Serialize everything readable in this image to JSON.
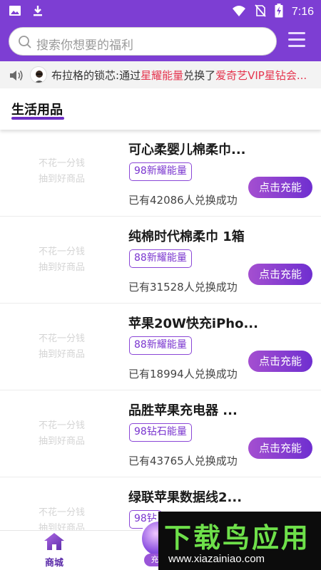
{
  "status_bar": {
    "time": "7:16",
    "left_icons": [
      "image-icon",
      "download-icon"
    ],
    "right_icons": [
      "wifi-icon",
      "no-sim-icon",
      "battery-charging-icon"
    ]
  },
  "search": {
    "placeholder": "搜索你想要的福利",
    "icon": "search-icon",
    "menu_icon": "menu-icon"
  },
  "notice": {
    "user": "布拉格的锁芯",
    "text_prefix": ":通过",
    "highlight_1": "星耀能量",
    "text_middle": "兑换了",
    "highlight_2": "爱奇艺VIP星钻会..."
  },
  "category": {
    "title": "生活用品"
  },
  "thumb_placeholder": {
    "line1": "不花一分钱",
    "line2": "抽到好商品"
  },
  "products": [
    {
      "name": "可心柔婴儿棉柔巾...",
      "badge": "98新耀能量",
      "sold": "已有42086人兑换成功",
      "button": "点击充能"
    },
    {
      "name": "纯棉时代棉柔巾 1箱",
      "badge": "88新耀能量",
      "sold": "已有31528人兑换成功",
      "button": "点击充能"
    },
    {
      "name": "苹果20W快充iPho...",
      "badge": "88新耀能量",
      "sold": "已有18994人兑换成功",
      "button": "点击充能"
    },
    {
      "name": "品胜苹果充电器 ...",
      "badge": "98钻石能量",
      "sold": "已有43765人兑换成功",
      "button": "点击充能"
    },
    {
      "name": "绿联苹果数据线2...",
      "badge": "98钻",
      "sold": "",
      "button": ""
    }
  ],
  "bottom_nav": {
    "home_label": "商城",
    "center_label": "充"
  },
  "watermark": {
    "title": "下载鸟应用",
    "url": "www.xiazainiao.com"
  },
  "colors": {
    "brand_purple": "#7d3ed3",
    "highlight_red": "#e5344e",
    "watermark_green": "#6ee04a"
  }
}
